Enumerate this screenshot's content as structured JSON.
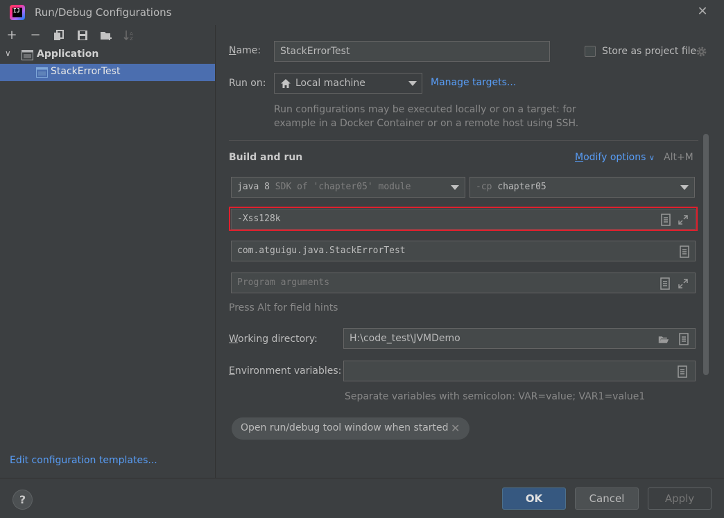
{
  "window": {
    "title": "Run/Debug Configurations",
    "close_glyph": "✕"
  },
  "toolbar": {
    "add": "+",
    "remove": "−"
  },
  "tree": {
    "group_label": "Application",
    "item_label": "StackErrorTest"
  },
  "left_footer": {
    "edit_templates": "Edit configuration templates..."
  },
  "form": {
    "name_label_first": "N",
    "name_label_rest": "ame:",
    "name_value": "StackErrorTest",
    "store_label": "Store as project file",
    "run_on_label": "Run on:",
    "run_on_value": "Local machine",
    "manage_targets": "Manage targets...",
    "run_on_hint_1": "Run configurations may be executed locally or on a target: for",
    "run_on_hint_2": "example in a Docker Container or on a remote host using SSH.",
    "build_run_title": "Build and run",
    "modify_options_first": "M",
    "modify_options_rest": "odify options",
    "modify_shortcut": "Alt+M",
    "jdk_main": "java 8",
    "jdk_detail": "SDK of 'chapter05' module",
    "cp_flag": "-cp",
    "cp_value": "chapter05",
    "vm_options_value": "-Xss128k",
    "main_class_value": "com.atguigu.java.StackErrorTest",
    "program_args_placeholder": "Program arguments",
    "field_hints": "Press Alt for field hints",
    "working_dir_label_first": "W",
    "working_dir_label_rest": "orking directory:",
    "working_dir_value": "H:\\code_test\\JVMDemo",
    "env_label_first": "E",
    "env_label_rest": "nvironment variables:",
    "env_value": "",
    "env_hint": "Separate variables with semicolon: VAR=value; VAR1=value1",
    "chip_label": "Open run/debug tool window when started",
    "chip_close": "✕"
  },
  "buttons": {
    "help": "?",
    "ok": "OK",
    "cancel": "Cancel",
    "apply": "Apply"
  },
  "colors": {
    "background": "#3c3f41",
    "selection": "#4b6eaf",
    "link": "#589df6",
    "highlight_border": "#e0202d",
    "ok_button": "#365880"
  }
}
